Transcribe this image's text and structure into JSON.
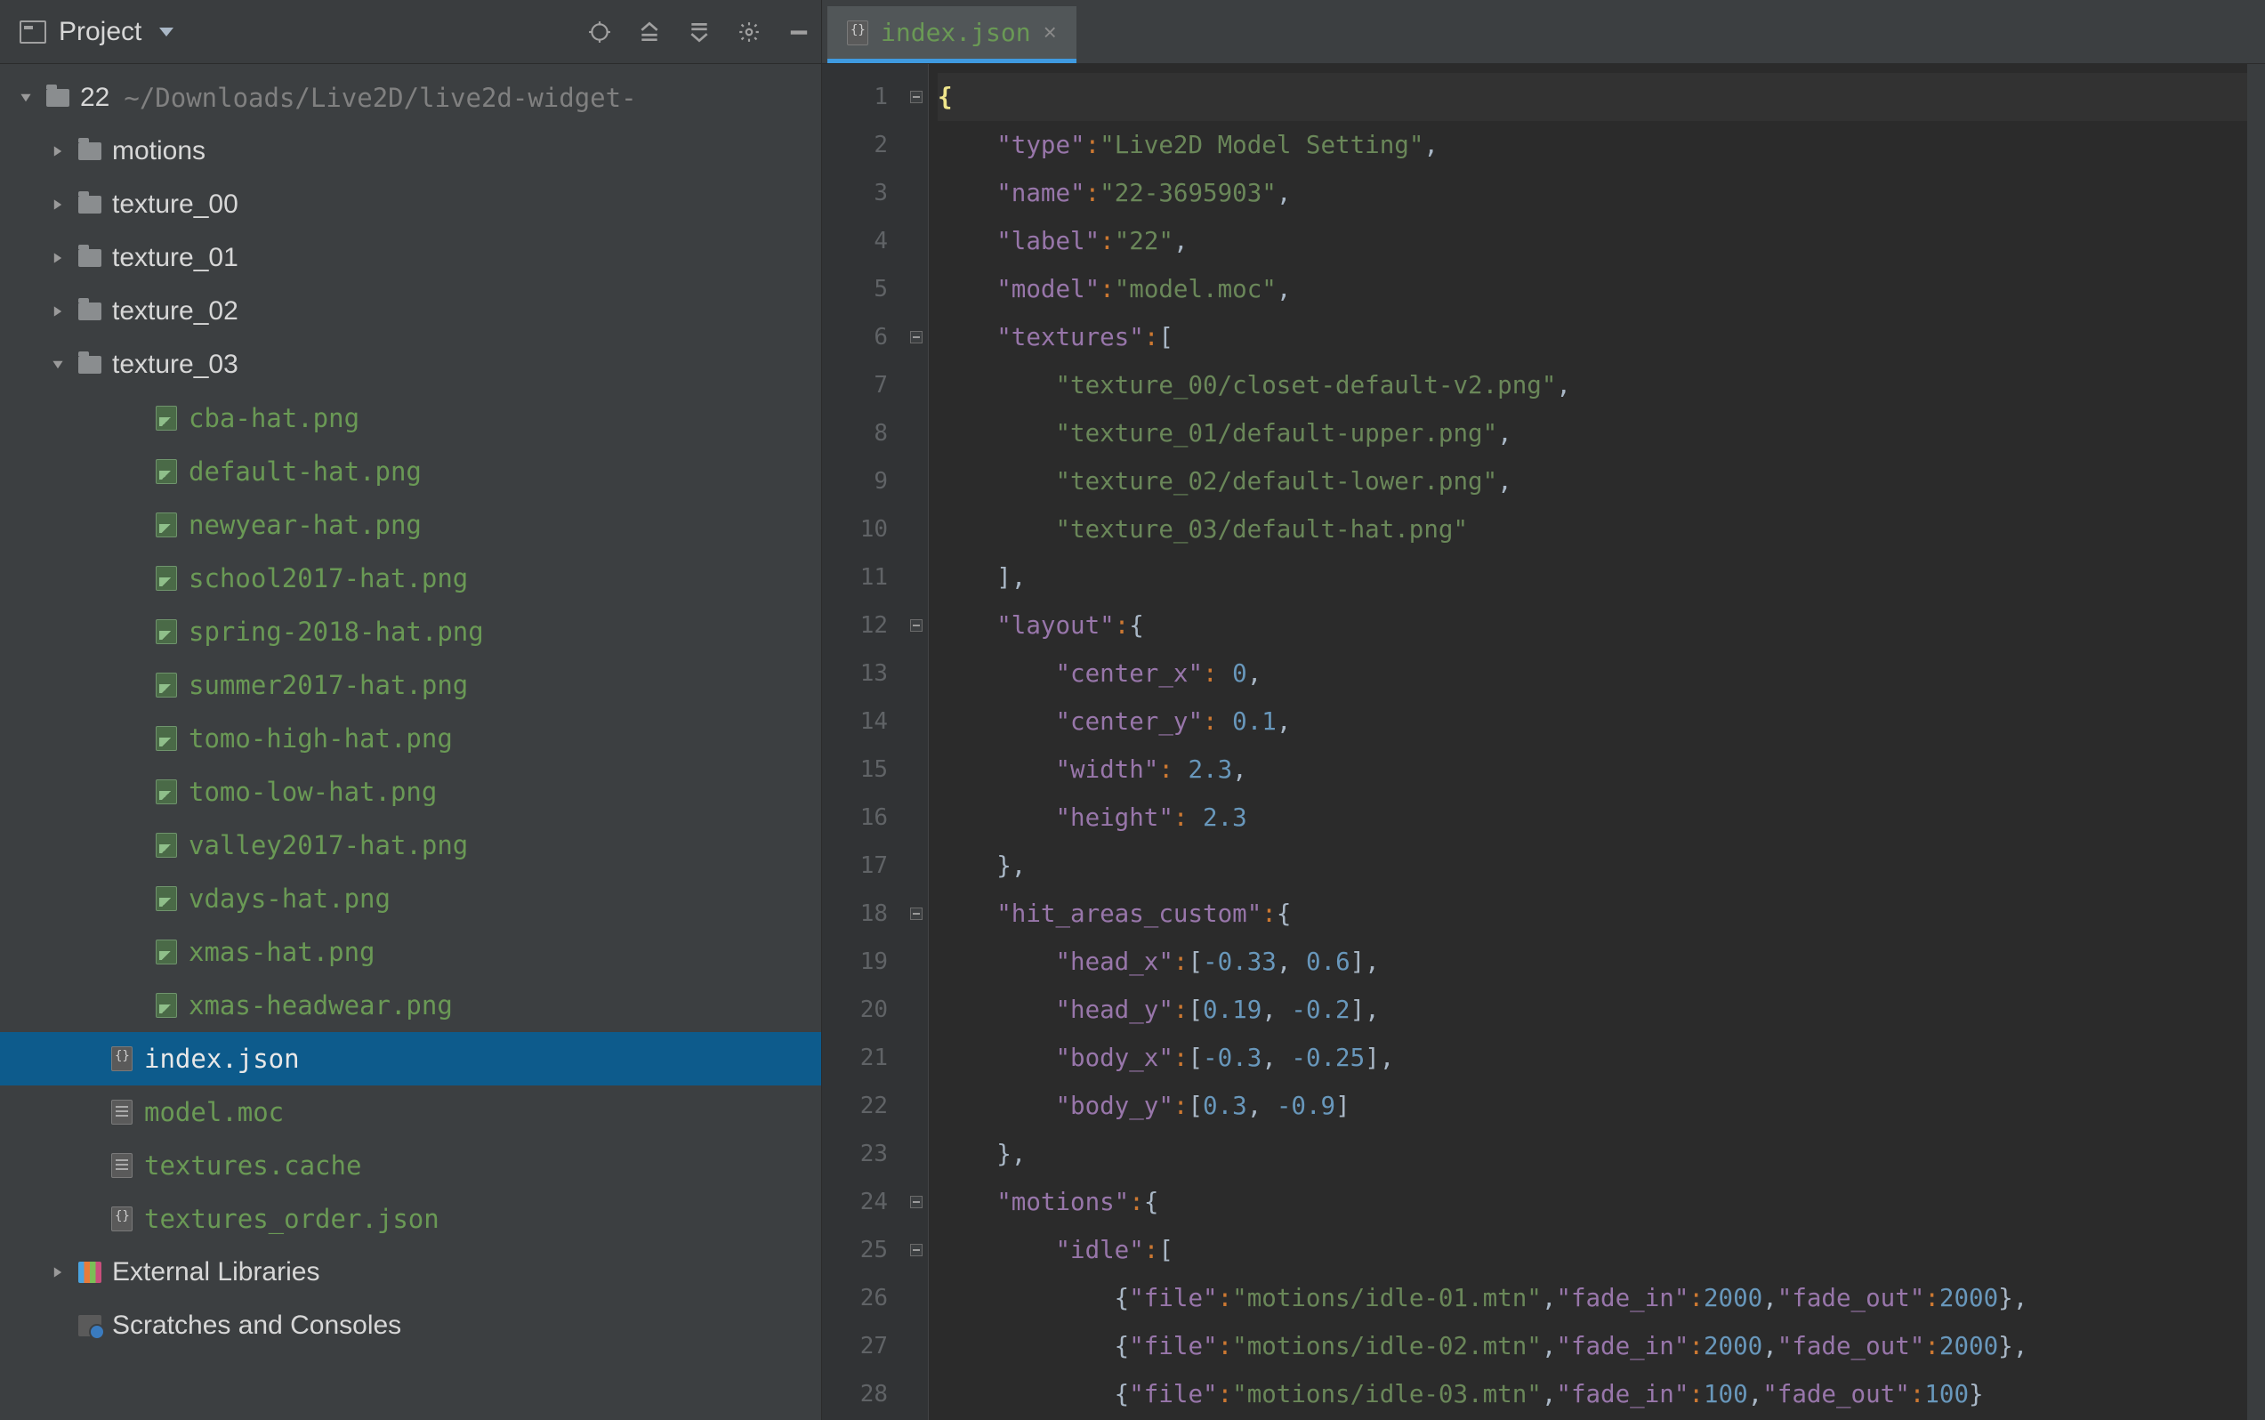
{
  "toolbar": {
    "project_label": "Project"
  },
  "project": {
    "root_name": "22",
    "root_path": "~/Downloads/Live2D/live2d-widget-",
    "folders": [
      {
        "name": "motions",
        "expanded": false
      },
      {
        "name": "texture_00",
        "expanded": false
      },
      {
        "name": "texture_01",
        "expanded": false
      },
      {
        "name": "texture_02",
        "expanded": false
      },
      {
        "name": "texture_03",
        "expanded": true
      }
    ],
    "texture_03_files": [
      "cba-hat.png",
      "default-hat.png",
      "newyear-hat.png",
      "school2017-hat.png",
      "spring-2018-hat.png",
      "summer2017-hat.png",
      "tomo-high-hat.png",
      "tomo-low-hat.png",
      "valley2017-hat.png",
      "vdays-hat.png",
      "xmas-hat.png",
      "xmas-headwear.png"
    ],
    "root_files": [
      {
        "name": "index.json",
        "selected": true,
        "kind": "json"
      },
      {
        "name": "model.moc",
        "selected": false,
        "kind": "moc"
      },
      {
        "name": "textures.cache",
        "selected": false,
        "kind": "moc"
      },
      {
        "name": "textures_order.json",
        "selected": false,
        "kind": "json"
      }
    ],
    "external_libs_label": "External Libraries",
    "scratches_label": "Scratches and Consoles"
  },
  "editor": {
    "tab_name": "index.json",
    "line_count": 28
  },
  "file_content": {
    "type": "Live2D Model Setting",
    "name": "22-3695903",
    "label": "22",
    "model": "model.moc",
    "textures": [
      "texture_00/closet-default-v2.png",
      "texture_01/default-upper.png",
      "texture_02/default-lower.png",
      "texture_03/default-hat.png"
    ],
    "layout": {
      "center_x": 0,
      "center_y": 0.1,
      "width": 2.3,
      "height": 2.3
    },
    "hit_areas_custom": {
      "head_x": [
        -0.33,
        0.6
      ],
      "head_y": [
        0.19,
        -0.2
      ],
      "body_x": [
        -0.3,
        -0.25
      ],
      "body_y": [
        0.3,
        -0.9
      ]
    },
    "motions": {
      "idle": [
        {
          "file": "motions/idle-01.mtn",
          "fade_in": 2000,
          "fade_out": 2000
        },
        {
          "file": "motions/idle-02.mtn",
          "fade_in": 2000,
          "fade_out": 2000
        },
        {
          "file": "motions/idle-03.mtn",
          "fade_in": 100,
          "fade_out": 100
        }
      ]
    }
  }
}
